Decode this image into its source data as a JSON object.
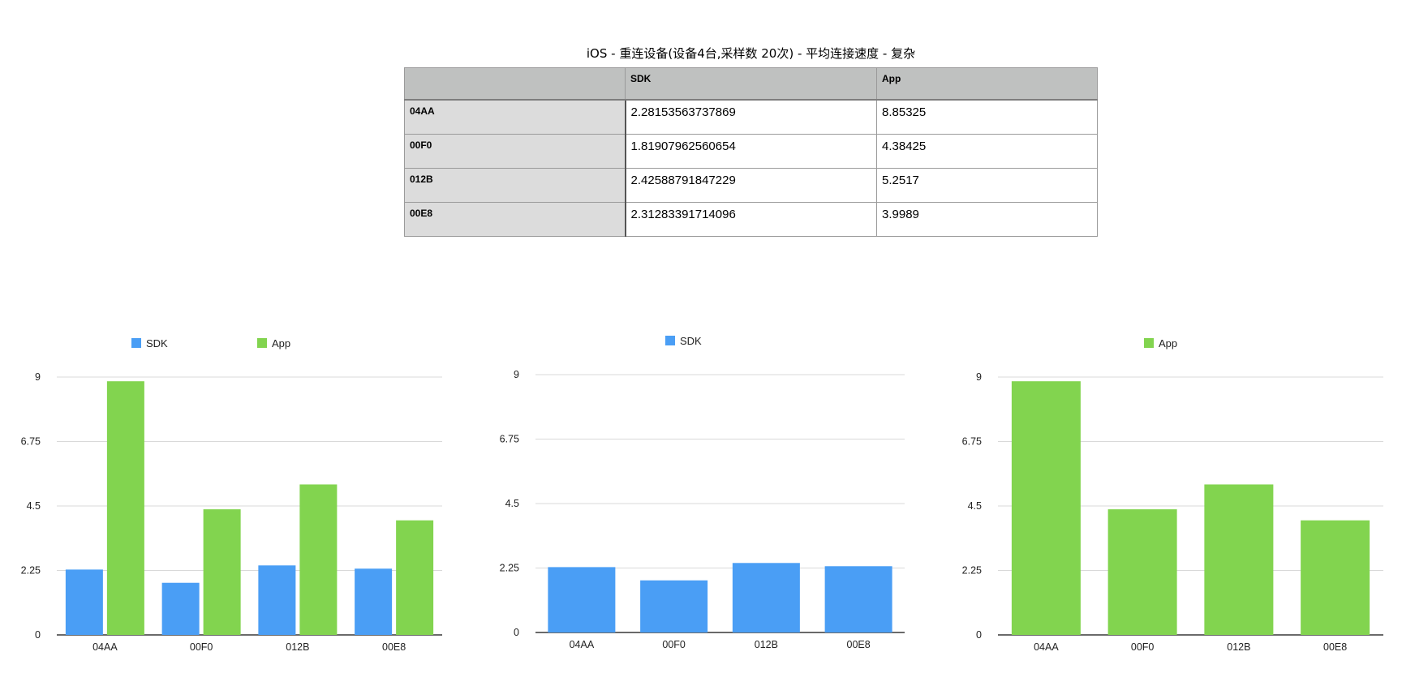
{
  "table": {
    "title": "iOS - 重连设备(设备4台,采样数 20次) - 平均连接速度 - 复杂",
    "columns": [
      "",
      "SDK",
      "App"
    ],
    "rows": [
      {
        "label": "04AA",
        "sdk": "2.28153563737869",
        "app": "8.85325"
      },
      {
        "label": "00F0",
        "sdk": "1.81907962560654",
        "app": "4.38425"
      },
      {
        "label": "012B",
        "sdk": "2.42588791847229",
        "app": "5.2517"
      },
      {
        "label": "00E8",
        "sdk": "2.31283391714096",
        "app": "3.9989"
      }
    ]
  },
  "chart_data": [
    {
      "type": "bar",
      "categories": [
        "04AA",
        "00F0",
        "012B",
        "00E8"
      ],
      "series": [
        {
          "name": "SDK",
          "color": "#4a9ef5",
          "values": [
            2.28153563737869,
            1.81907962560654,
            2.42588791847229,
            2.31283391714096
          ]
        },
        {
          "name": "App",
          "color": "#82d44f",
          "values": [
            8.85325,
            4.38425,
            5.2517,
            3.9989
          ]
        }
      ],
      "yticks": [
        "0",
        "2.25",
        "4.5",
        "6.75",
        "9"
      ],
      "ylim": [
        0,
        9
      ],
      "grid": true,
      "legend": "top"
    },
    {
      "type": "bar",
      "categories": [
        "04AA",
        "00F0",
        "012B",
        "00E8"
      ],
      "series": [
        {
          "name": "SDK",
          "color": "#4a9ef5",
          "values": [
            2.28153563737869,
            1.81907962560654,
            2.42588791847229,
            2.31283391714096
          ]
        }
      ],
      "yticks": [
        "0",
        "2.25",
        "4.5",
        "6.75",
        "9"
      ],
      "ylim": [
        0,
        9
      ],
      "grid": true,
      "legend": "top"
    },
    {
      "type": "bar",
      "categories": [
        "04AA",
        "00F0",
        "012B",
        "00E8"
      ],
      "series": [
        {
          "name": "App",
          "color": "#82d44f",
          "values": [
            8.85325,
            4.38425,
            5.2517,
            3.9989
          ]
        }
      ],
      "yticks": [
        "0",
        "2.25",
        "4.5",
        "6.75",
        "9"
      ],
      "ylim": [
        0,
        9
      ],
      "grid": true,
      "legend": "top"
    }
  ]
}
